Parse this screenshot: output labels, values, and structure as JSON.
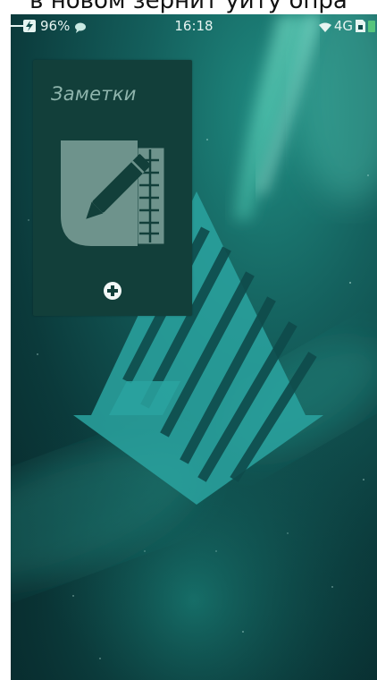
{
  "caption": {
    "text": "в новом зернит уиту опра"
  },
  "status_bar": {
    "battery_percent": "96%",
    "time": "16:18",
    "network": "4G",
    "icons": [
      "charging-bolt-icon",
      "chat-bubble-icon",
      "wifi-icon",
      "sim-card-icon",
      "battery-icon"
    ]
  },
  "cover": {
    "title": "Заметки",
    "icon": "notes-pencil-icon",
    "action_icon": "add-icon"
  },
  "wallpaper": {
    "logo": "sailfish-logo",
    "colors": {
      "base": "#0c3b3c",
      "aurora": "#35b9a6",
      "logo": "#2aa3a0"
    }
  }
}
